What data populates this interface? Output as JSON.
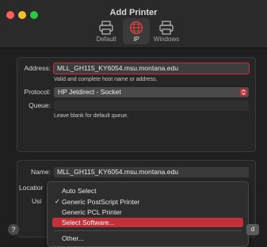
{
  "window": {
    "title": "Add Printer"
  },
  "toolbar": {
    "items": [
      {
        "label": "Default",
        "icon": "printer-icon"
      },
      {
        "label": "IP",
        "icon": "globe-icon"
      },
      {
        "label": "Windows",
        "icon": "printer-icon"
      }
    ],
    "selected": "IP"
  },
  "form": {
    "address_label": "Address:",
    "address_value": "MLL_GH115_KY6054.msu.montana.edu",
    "address_hint": "Valid and complete host name or address.",
    "protocol_label": "Protocol:",
    "protocol_value": "HP Jetdirect - Socket",
    "queue_label": "Queue:",
    "queue_value": "",
    "queue_hint": "Leave blank for default queue.",
    "name_label": "Name:",
    "name_value": "MLL_GH115_KY6054.msu.montana.edu",
    "location_label": "Locatior",
    "use_label": "Usi"
  },
  "menu": {
    "items": [
      {
        "label": "Auto Select",
        "checked": false,
        "highlighted": false
      },
      {
        "label": "Generic PostScript Printer",
        "checked": true,
        "highlighted": false
      },
      {
        "label": "Generic PCL Printer",
        "checked": false,
        "highlighted": false
      },
      {
        "label": "Select Software...",
        "checked": false,
        "highlighted": true
      },
      {
        "label": "Other...",
        "checked": false,
        "highlighted": false
      }
    ],
    "check_glyph": "✓"
  },
  "footer": {
    "help_label": "?",
    "add_label": "d"
  },
  "colors": {
    "accent": "#c8313a",
    "background": "#1f1f1f",
    "panel": "#262626"
  }
}
